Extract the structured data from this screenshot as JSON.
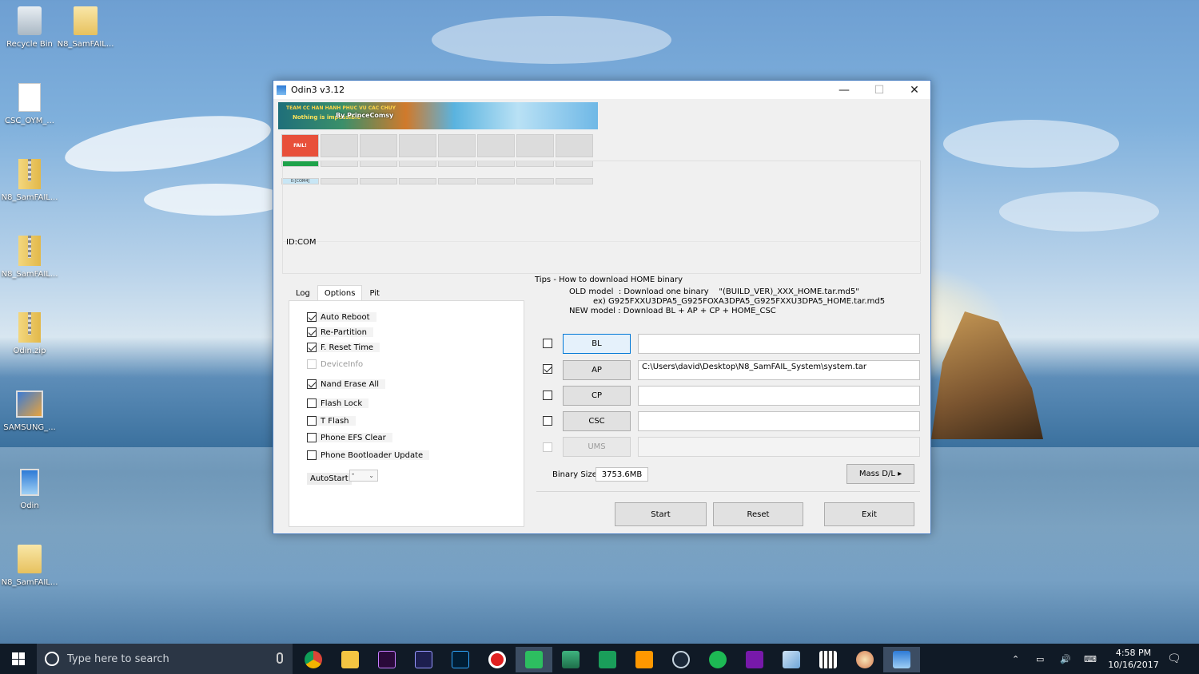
{
  "desktop": {
    "icons": [
      {
        "label": "Recycle Bin"
      },
      {
        "label": "N8_SamFAIL..."
      },
      {
        "label": "CSC_OYM_..."
      },
      {
        "label": "N8_SamFAIL..."
      },
      {
        "label": "N8_SamFAIL..."
      },
      {
        "label": "Odin.zip"
      },
      {
        "label": "SAMSUNG_..."
      },
      {
        "label": "Odin"
      },
      {
        "label": "N8_SamFAIL..."
      }
    ]
  },
  "window": {
    "title": "Odin3 v3.12",
    "banner": {
      "line1": "TEAM CC HAN HANH PHUC VU CAC CHUY",
      "line2": "Nothing is impossible",
      "line3": "By PrinceComsy"
    },
    "status": {
      "fail_label": "FAIL!",
      "com_label": "0:[COM4]"
    },
    "id_com": "ID:COM",
    "tabs": [
      {
        "label": "Log",
        "active": false
      },
      {
        "label": "Options",
        "active": true
      },
      {
        "label": "Pit",
        "active": false
      }
    ],
    "options": [
      {
        "label": "Auto Reboot",
        "checked": true,
        "enabled": true
      },
      {
        "label": "Re-Partition",
        "checked": true,
        "enabled": true
      },
      {
        "label": "F. Reset Time",
        "checked": true,
        "enabled": true
      },
      {
        "label": "DeviceInfo",
        "checked": false,
        "enabled": false
      },
      {
        "label": "Nand Erase All",
        "checked": true,
        "enabled": true
      },
      {
        "label": "Flash Lock",
        "checked": false,
        "enabled": true
      },
      {
        "label": "T Flash",
        "checked": false,
        "enabled": true
      },
      {
        "label": "Phone EFS Clear",
        "checked": false,
        "enabled": true
      },
      {
        "label": "Phone Bootloader Update",
        "checked": false,
        "enabled": true
      }
    ],
    "autostart": {
      "label": "AutoStart",
      "value": "-"
    },
    "tips": {
      "title": "Tips - How to download HOME binary",
      "line1": "OLD model  : Download one binary    \"(BUILD_VER)_XXX_HOME.tar.md5\"",
      "line2": "ex) G925FXXU3DPA5_G925FOXA3DPA5_G925FXXU3DPA5_HOME.tar.md5",
      "line3": "NEW model : Download BL + AP + CP + HOME_CSC"
    },
    "files": [
      {
        "button": "BL",
        "path": "",
        "checked": false
      },
      {
        "button": "AP",
        "path": "C:\\Users\\david\\Desktop\\N8_SamFAIL_System\\system.tar",
        "checked": true
      },
      {
        "button": "CP",
        "path": "",
        "checked": false
      },
      {
        "button": "CSC",
        "path": "",
        "checked": false
      },
      {
        "button": "UMS",
        "path": "",
        "checked": false
      }
    ],
    "binary_size": {
      "label": "Binary Size",
      "value": "3753.6MB"
    },
    "mass_dl": "Mass D/L ▸",
    "buttons": {
      "start": "Start",
      "reset": "Reset",
      "exit": "Exit"
    }
  },
  "taskbar": {
    "search_placeholder": "Type here to search",
    "time": "4:58 PM",
    "date": "10/16/2017"
  }
}
